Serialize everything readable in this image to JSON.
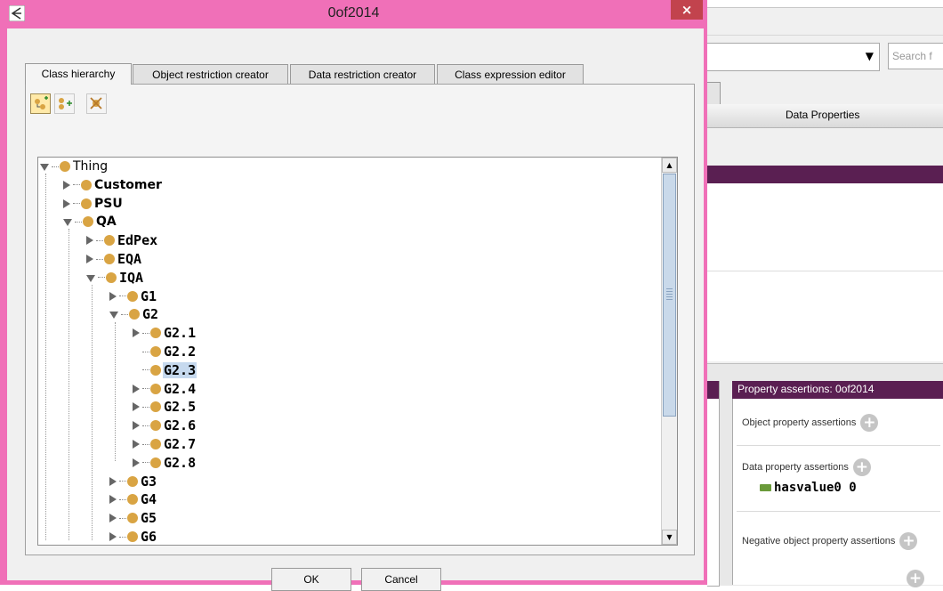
{
  "dialog": {
    "title": "0of2014",
    "close_symbol": "×",
    "tabs": [
      "Class hierarchy",
      "Object restriction creator",
      "Data restriction creator",
      "Class expression editor"
    ],
    "active_tab": "Class hierarchy",
    "toolbar": [
      "add-subclass-icon",
      "add-sibling-class-icon",
      "delete-class-icon"
    ],
    "tree": [
      {
        "label": "Thing",
        "depth": 0,
        "state": "open",
        "style": "sans"
      },
      {
        "label": "Customer",
        "depth": 1,
        "state": "closed",
        "style": "bold-sans"
      },
      {
        "label": "PSU",
        "depth": 1,
        "state": "closed",
        "style": "bold-sans"
      },
      {
        "label": "QA",
        "depth": 1,
        "state": "open",
        "style": "bold-sans"
      },
      {
        "label": "EdPex",
        "depth": 2,
        "state": "closed"
      },
      {
        "label": "EQA",
        "depth": 2,
        "state": "closed"
      },
      {
        "label": "IQA",
        "depth": 2,
        "state": "open"
      },
      {
        "label": "G1",
        "depth": 3,
        "state": "closed"
      },
      {
        "label": "G2",
        "depth": 3,
        "state": "open"
      },
      {
        "label": "G2.1",
        "depth": 4,
        "state": "closed"
      },
      {
        "label": "G2.2",
        "depth": 4,
        "state": "leaf"
      },
      {
        "label": "G2.3",
        "depth": 4,
        "state": "leaf",
        "selected": true
      },
      {
        "label": "G2.4",
        "depth": 4,
        "state": "closed"
      },
      {
        "label": "G2.5",
        "depth": 4,
        "state": "closed"
      },
      {
        "label": "G2.6",
        "depth": 4,
        "state": "closed"
      },
      {
        "label": "G2.7",
        "depth": 4,
        "state": "closed"
      },
      {
        "label": "G2.8",
        "depth": 4,
        "state": "closed"
      },
      {
        "label": "G3",
        "depth": 3,
        "state": "closed"
      },
      {
        "label": "G4",
        "depth": 3,
        "state": "closed"
      },
      {
        "label": "G5",
        "depth": 3,
        "state": "closed"
      },
      {
        "label": "G6",
        "depth": 3,
        "state": "closed"
      }
    ],
    "scrollbar": {
      "up_symbol": "▲",
      "down_symbol": "▼"
    },
    "buttons": {
      "ok": "OK",
      "cancel": "Cancel"
    }
  },
  "background_window": {
    "search_placeholder": "Search f",
    "combo_arrow": "▼",
    "tab_label": "Data Properties",
    "property_assertions": {
      "header": "Property assertions: 0of2014",
      "object_property_assertions": "Object property assertions",
      "data_property_assertions": "Data property assertions",
      "data_property_value": "hasvalue0  0",
      "negative_object_property_assertions": "Negative object property assertions",
      "plus_symbol": "+"
    }
  },
  "colors": {
    "dialog_frame": "#f070b8",
    "close_button": "#c2434d",
    "class_dot": "#d9a443",
    "selection": "#c6d9ee",
    "header_purple": "#5a1f52",
    "data_property_swatch": "#6a9a3a"
  }
}
